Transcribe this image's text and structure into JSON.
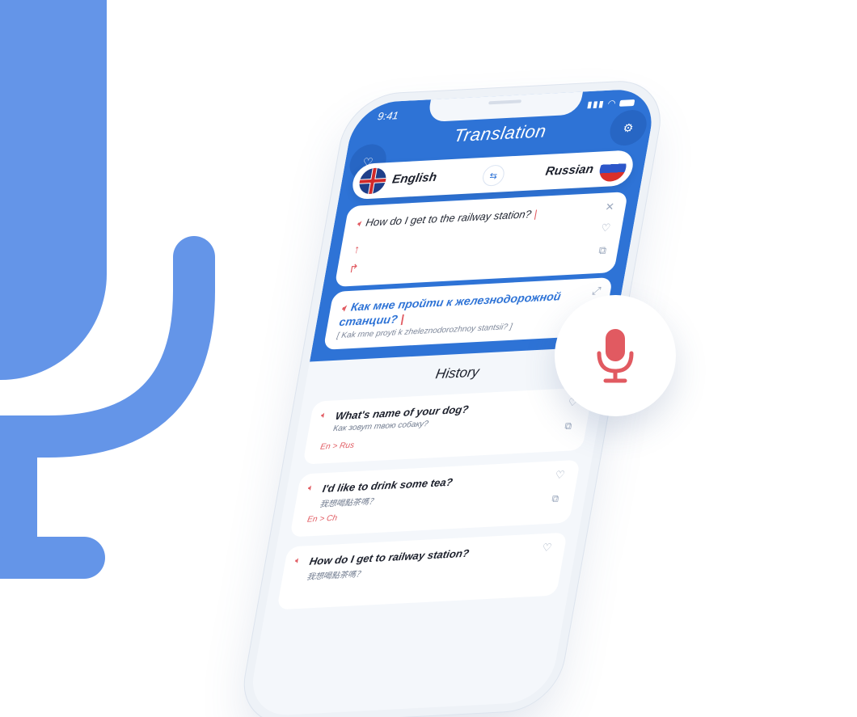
{
  "colors": {
    "brand_blue": "#2e73d6",
    "accent_red": "#e15a61",
    "light_bg": "#f4f7fb",
    "bg_mic": "#6495e8"
  },
  "status_bar": {
    "time": "9:41",
    "icons": [
      "signal-icon",
      "wifi-icon",
      "battery-icon"
    ]
  },
  "header": {
    "title": "Translation",
    "left_icon": "heart-icon",
    "right_icon": "gear-icon"
  },
  "languages": {
    "source": "English",
    "target": "Russian",
    "swap_icon": "swap-icon"
  },
  "input_card": {
    "text": "How do I get to the railway station?",
    "cursor": "|",
    "icons": [
      "speaker-icon",
      "arrow-up-icon",
      "share-icon",
      "close-icon",
      "heart-icon",
      "copy-icon"
    ]
  },
  "output_card": {
    "text": "Как мне пройти к железнодорожной станции?",
    "cursor": "|",
    "transliteration": "[ Kak mne proyti k zheleznodorozhnoy stantsii? ]",
    "icons": [
      "speaker-icon",
      "expand-icon"
    ]
  },
  "history": {
    "title": "History",
    "items": [
      {
        "phrase": "What's name of your dog?",
        "translation": "Как зовут твою собаку?",
        "pair": "En > Rus"
      },
      {
        "phrase": "I'd like to drink some tea?",
        "translation": "我想喝點茶嗎？",
        "pair": "En > Ch"
      },
      {
        "phrase": "How do I get to railway station?",
        "translation": "我想喝點茶嗎？",
        "pair": ""
      }
    ]
  },
  "fab": {
    "icon": "microphone-icon"
  }
}
